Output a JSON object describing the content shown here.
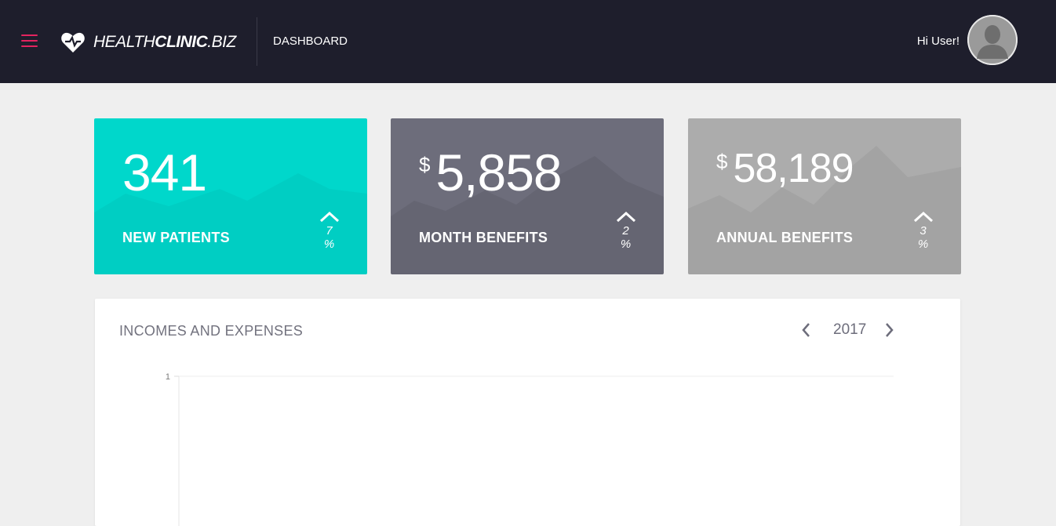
{
  "header": {
    "logo_light": "HEALTH",
    "logo_bold": "CLINIC",
    "logo_tail": ".BIZ",
    "breadcrumb": "DASHBOARD",
    "greeting": "Hi User!",
    "menu_icon": "hamburger-icon",
    "menu_color": "#e4245f",
    "background": "#1e1e2c"
  },
  "stats": [
    {
      "value": "341",
      "currency": "",
      "label": "NEW PATIENTS",
      "change": "7 %",
      "color": "#00d7cb",
      "trend_icon": "chevron-up-icon"
    },
    {
      "value": "5,858",
      "currency": "$",
      "label": "MONTH BENEFITS",
      "change": "2 %",
      "color": "#6d6d7b",
      "trend_icon": "chevron-up-icon"
    },
    {
      "value": "58,189",
      "currency": "$",
      "label": "ANNUAL BENEFITS",
      "change": "3 %",
      "color": "#acacac",
      "trend_icon": "chevron-up-icon"
    }
  ],
  "panel": {
    "title": "INCOMES AND EXPENSES",
    "year": "2017",
    "prev_icon": "chevron-left-icon",
    "next_icon": "chevron-right-icon"
  },
  "chart_data": {
    "type": "line",
    "title": "",
    "xlabel": "",
    "ylabel": "",
    "y_ticks": [
      "1"
    ],
    "ylim": [
      0,
      1
    ],
    "series": [],
    "grid": true
  }
}
